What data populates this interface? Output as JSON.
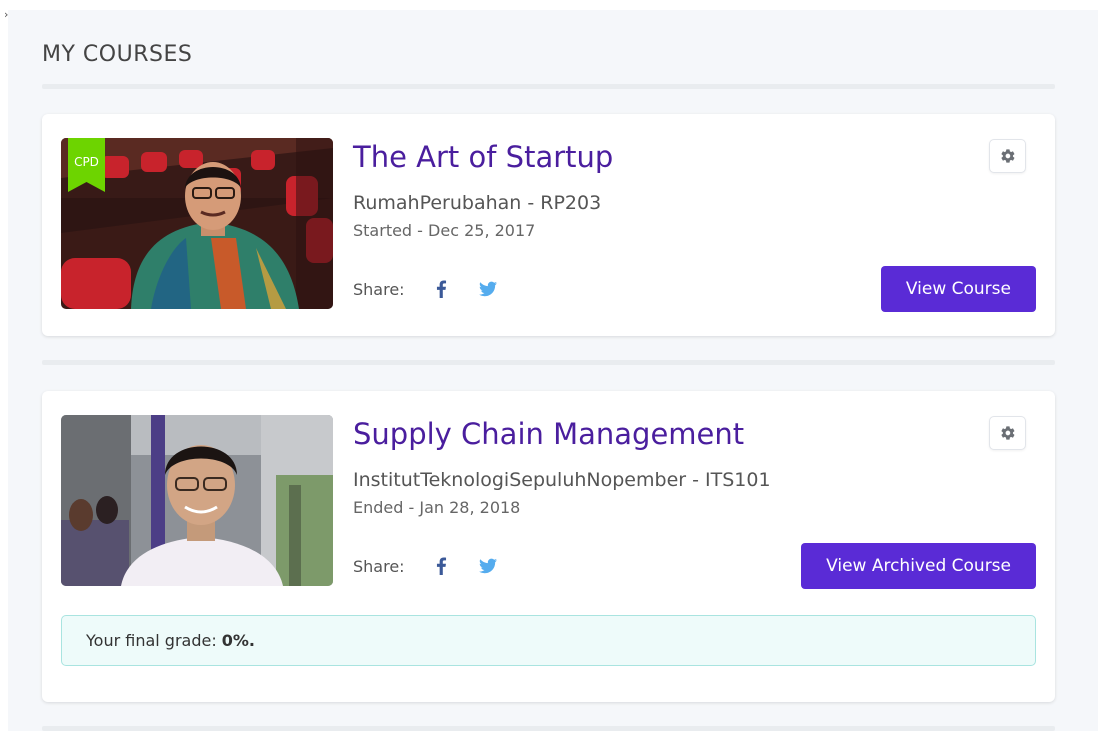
{
  "page": {
    "heading": "MY COURSES"
  },
  "courses": [
    {
      "title": "The Art of Startup",
      "org": "RumahPerubahan - RP203",
      "date": "Started - Dec 25, 2017",
      "badge": "CPD",
      "share_label": "Share:",
      "button_label": "View Course"
    },
    {
      "title": "Supply Chain Management",
      "org": "InstitutTeknologiSepuluhNopember - ITS101",
      "date": "Ended - Jan 28, 2018",
      "share_label": "Share:",
      "button_label": "View Archived Course",
      "grade_label": "Your final grade:",
      "grade_value": "0%."
    }
  ],
  "colors": {
    "title": "#4a1e9e",
    "button": "#5a2bd6",
    "badge": "#6dd400",
    "facebook": "#3b5998",
    "twitter": "#55acee"
  },
  "icons": {
    "settings": "gear-icon",
    "facebook": "facebook-icon",
    "twitter": "twitter-icon"
  }
}
